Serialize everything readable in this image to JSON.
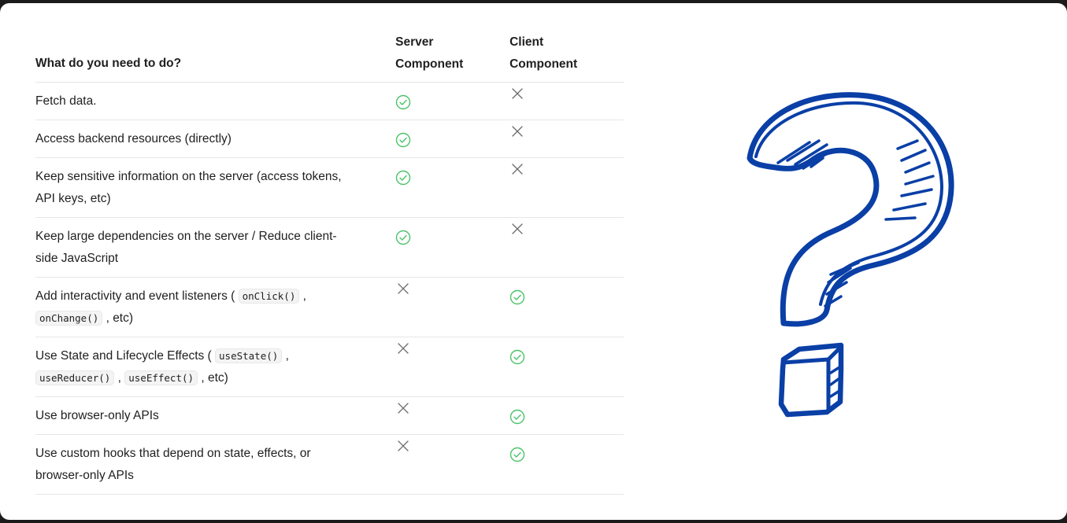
{
  "header": {
    "col_task": "What do you need to do?",
    "col_server_line1": "Server",
    "col_server_line2": "Component",
    "col_client_line1": "Client",
    "col_client_line2": "Component"
  },
  "rows": [
    {
      "parts": [
        "Fetch data."
      ],
      "server": "check",
      "client": "cross"
    },
    {
      "parts": [
        "Access backend resources (directly)"
      ],
      "server": "check",
      "client": "cross"
    },
    {
      "line1": "Keep sensitive information on the server (access tokens,",
      "line2": "API keys, etc)",
      "server": "check",
      "client": "cross"
    },
    {
      "line1": "Keep large dependencies on the server / Reduce client-",
      "line2": "side JavaScript",
      "server": "check",
      "client": "cross"
    },
    {
      "line1_text": "Add interactivity and event listeners (",
      "line1_code": "onClick()",
      "line1_end": ",",
      "line2_code": "onChange()",
      "line2_end": ", etc)",
      "server": "cross",
      "client": "check"
    },
    {
      "line1_text": "Use State and Lifecycle Effects (",
      "line1_code": "useState()",
      "line1_end": ",",
      "line2_code1": "useReducer()",
      "line2_sep": ",",
      "line2_code2": "useEffect()",
      "line2_end": ", etc)",
      "server": "cross",
      "client": "check"
    },
    {
      "parts": [
        "Use browser-only APIs"
      ],
      "server": "cross",
      "client": "check"
    },
    {
      "line1": "Use custom hooks that depend on state, effects, or",
      "line2": "browser-only APIs",
      "server": "cross",
      "client": "check"
    }
  ],
  "icons": {
    "check": "check-circle-icon",
    "cross": "x-icon",
    "illustration": "question-mark-icon"
  },
  "colors": {
    "check": "#4cc36a",
    "cross": "#6b6b6b",
    "question_mark": "#0a3fa6"
  }
}
